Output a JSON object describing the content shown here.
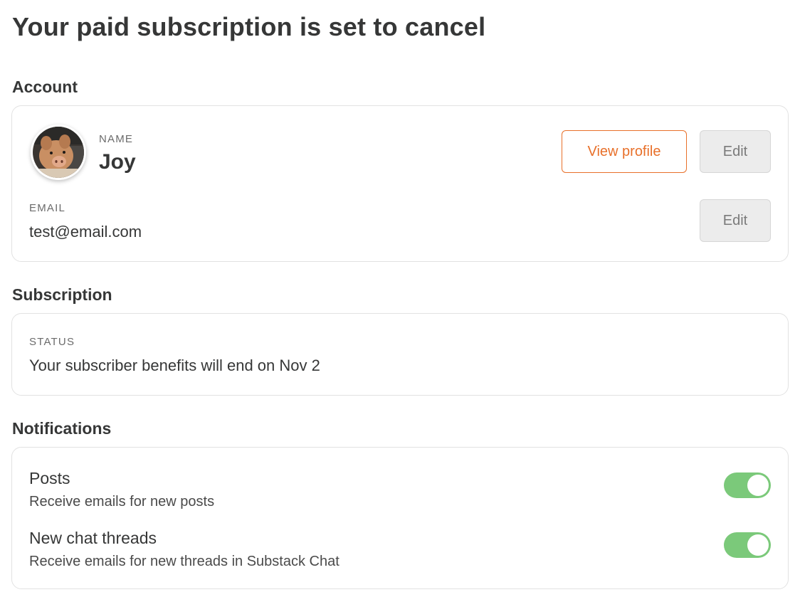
{
  "page_title": "Your paid subscription is set to cancel",
  "account": {
    "section_title": "Account",
    "name_label": "NAME",
    "name_value": "Joy",
    "view_profile_label": "View profile",
    "edit_name_label": "Edit",
    "email_label": "EMAIL",
    "email_value": "test@email.com",
    "edit_email_label": "Edit"
  },
  "subscription": {
    "section_title": "Subscription",
    "status_label": "STATUS",
    "status_value": "Your subscriber benefits will end on Nov 2"
  },
  "notifications": {
    "section_title": "Notifications",
    "items": [
      {
        "title": "Posts",
        "description": "Receive emails for new posts",
        "enabled": true
      },
      {
        "title": "New chat threads",
        "description": "Receive emails for new threads in Substack Chat",
        "enabled": true
      }
    ]
  },
  "colors": {
    "accent": "#e8702a",
    "toggle_on": "#7bc97a",
    "text": "#363737"
  }
}
